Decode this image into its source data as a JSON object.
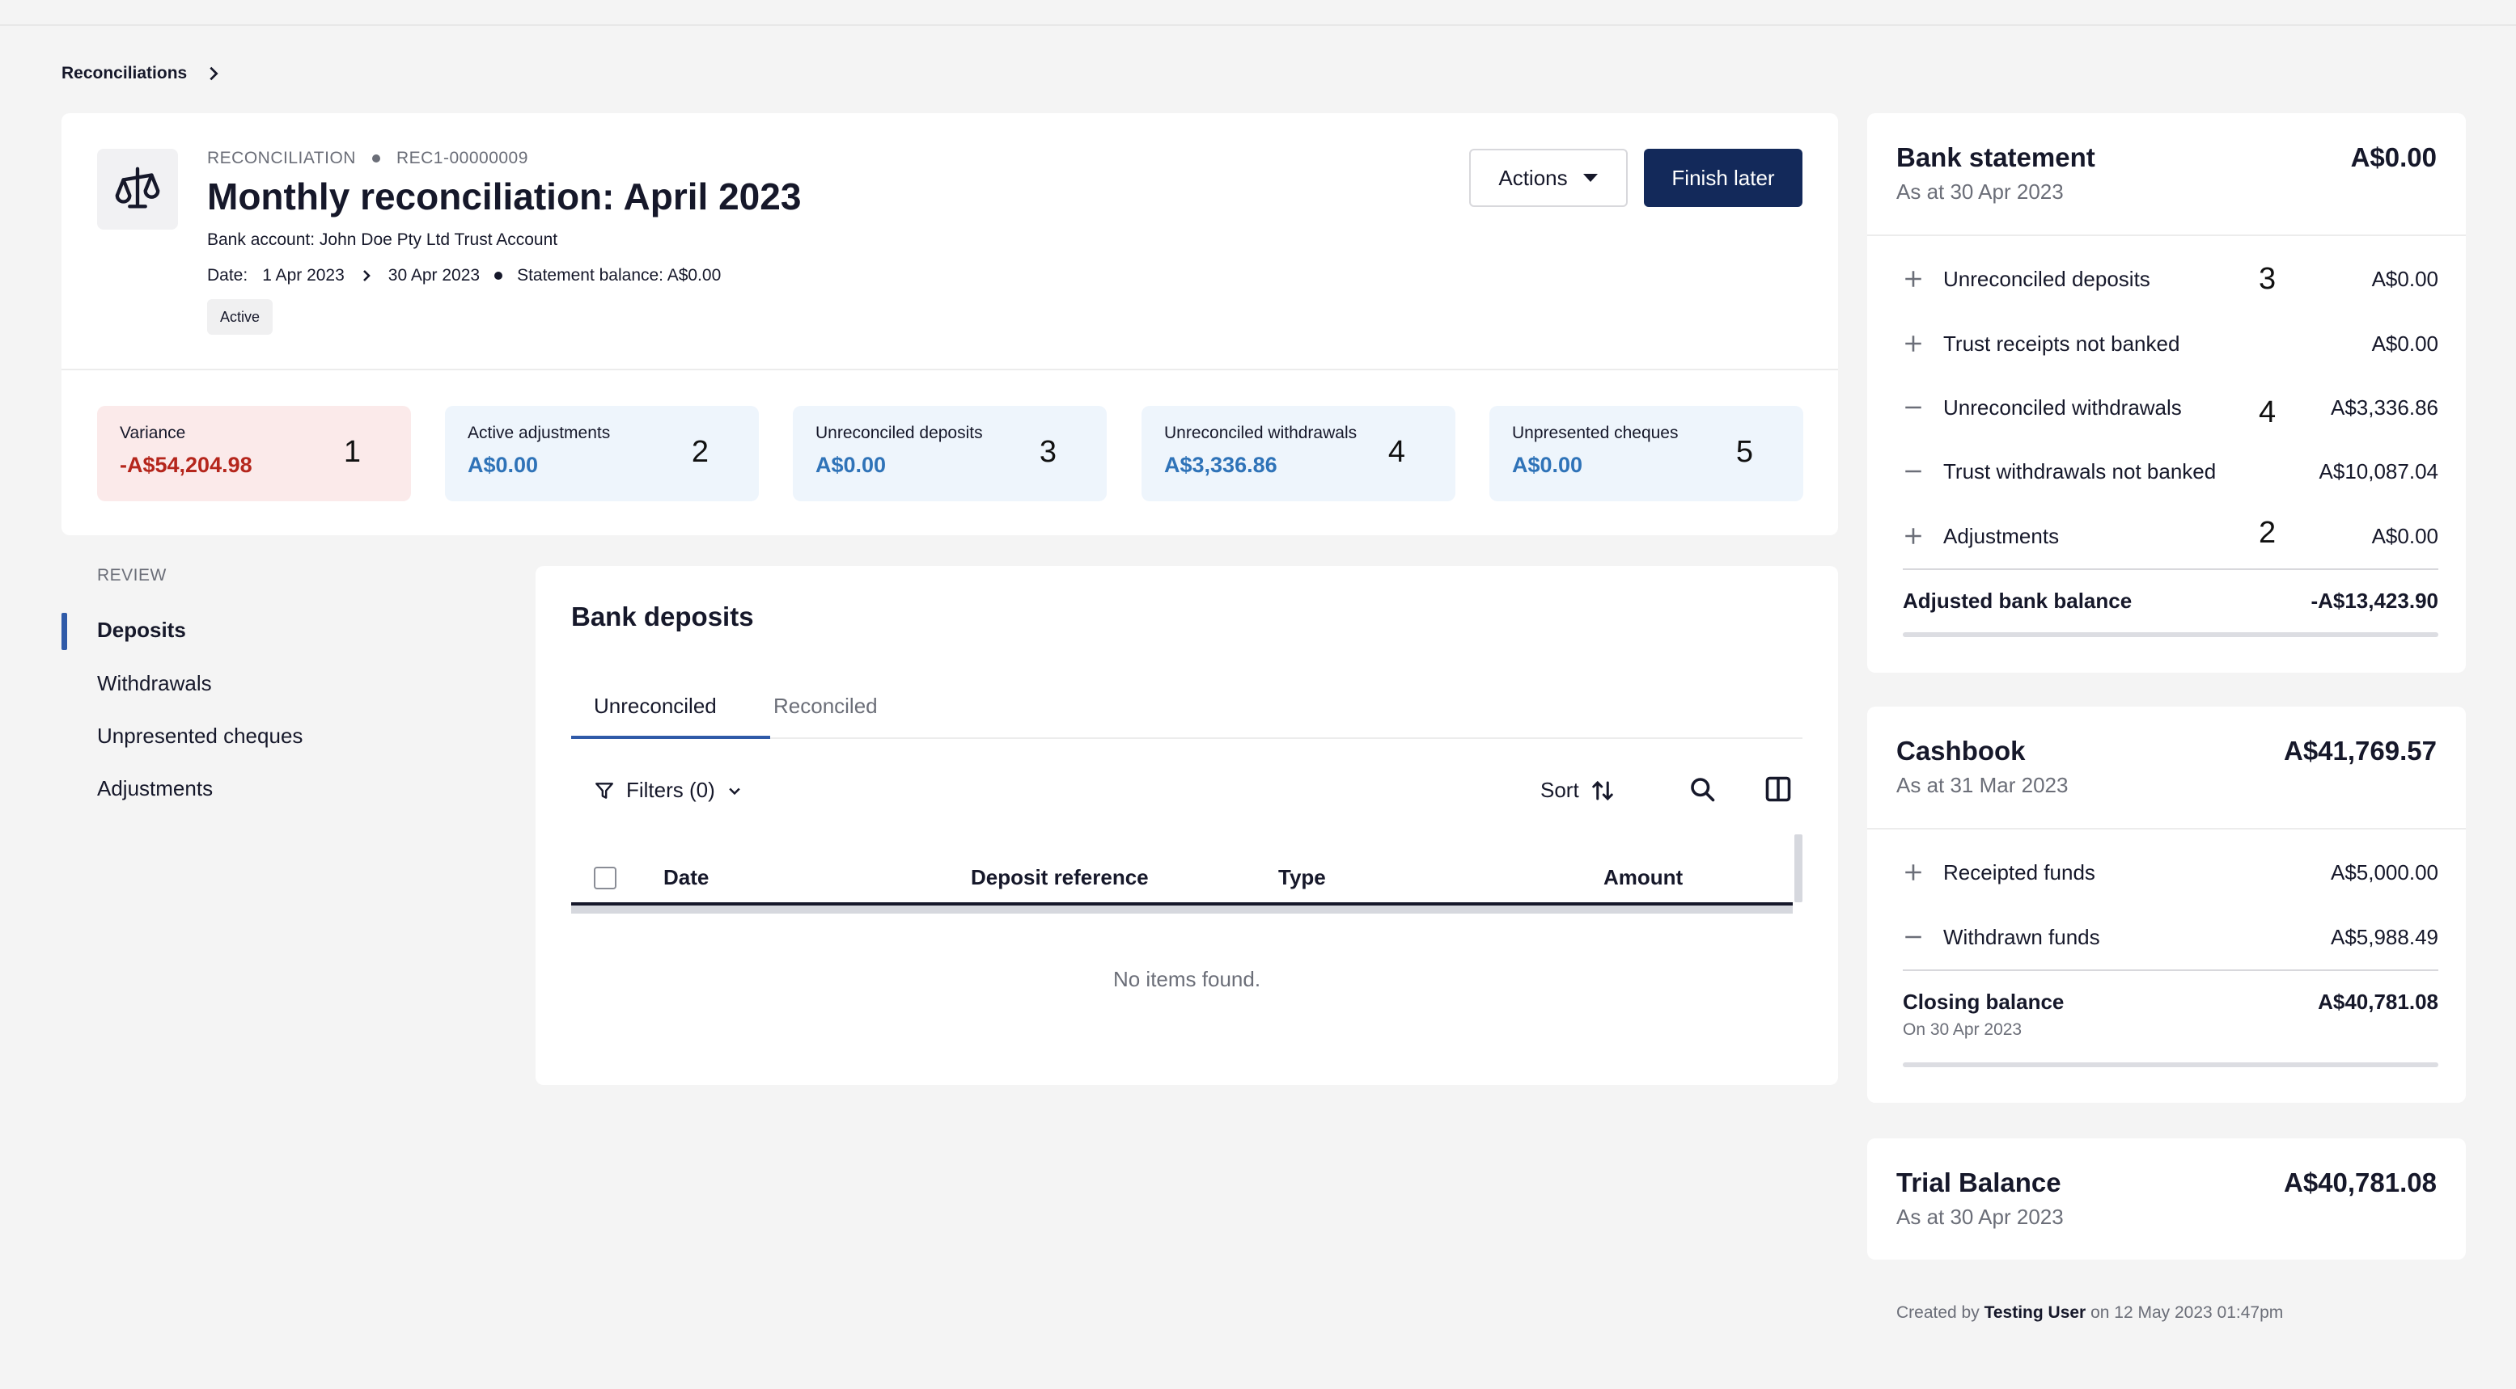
{
  "breadcrumb": {
    "root": "Reconciliations"
  },
  "header": {
    "kind_label": "RECONCILIATION",
    "reference": "REC1-00000009",
    "title": "Monthly reconciliation: April 2023",
    "bank_account": "Bank account: John Doe Pty Ltd Trust Account",
    "date_label": "Date:",
    "date_from": "1 Apr 2023",
    "date_to": "30 Apr 2023",
    "statement_balance": "Statement balance: A$0.00",
    "status": "Active",
    "actions_label": "Actions",
    "finish_label": "Finish later",
    "icon": "scales-icon"
  },
  "stats": [
    {
      "label": "Variance",
      "value": "-A$54,204.98",
      "num": "1"
    },
    {
      "label": "Active adjustments",
      "value": "A$0.00",
      "num": "2"
    },
    {
      "label": "Unreconciled deposits",
      "value": "A$0.00",
      "num": "3"
    },
    {
      "label": "Unreconciled withdrawals",
      "value": "A$3,336.86",
      "num": "4"
    },
    {
      "label": "Unpresented cheques",
      "value": "A$0.00",
      "num": "5"
    }
  ],
  "review": {
    "title": "REVIEW",
    "items": [
      "Deposits",
      "Withdrawals",
      "Unpresented cheques",
      "Adjustments"
    ],
    "active": "Deposits"
  },
  "deposits": {
    "title": "Bank deposits",
    "tabs": [
      "Unreconciled",
      "Reconciled"
    ],
    "filters_label": "Filters (0)",
    "sort_label": "Sort",
    "columns": [
      "Date",
      "Deposit reference",
      "Type",
      "Amount"
    ],
    "empty_message": "No items found."
  },
  "bank_statement": {
    "title": "Bank statement",
    "subtitle": "As at 30 Apr 2023",
    "total": "A$0.00",
    "rows": [
      {
        "sign": "plus",
        "label": "Unreconciled deposits",
        "num": "3",
        "amount": "A$0.00"
      },
      {
        "sign": "plus",
        "label": "Trust receipts not banked",
        "num": "",
        "amount": "A$0.00"
      },
      {
        "sign": "minus",
        "label": "Unreconciled withdrawals",
        "num": "4",
        "amount": "A$3,336.86"
      },
      {
        "sign": "minus",
        "label": "Trust withdrawals not banked",
        "num": "",
        "amount": "A$10,087.04"
      },
      {
        "sign": "plus",
        "label": "Adjustments",
        "num": "2",
        "amount": "A$0.00"
      }
    ],
    "adjusted_label": "Adjusted bank balance",
    "adjusted_amount": "-A$13,423.90"
  },
  "cashbook": {
    "title": "Cashbook",
    "subtitle": "As at 31 Mar 2023",
    "total": "A$41,769.57",
    "rows": [
      {
        "sign": "plus",
        "label": "Receipted funds",
        "amount": "A$5,000.00"
      },
      {
        "sign": "minus",
        "label": "Withdrawn funds",
        "amount": "A$5,988.49"
      }
    ],
    "closing_label": "Closing balance",
    "closing_sub": "On 30 Apr 2023",
    "closing_amount": "A$40,781.08"
  },
  "trial_balance": {
    "title": "Trial Balance",
    "subtitle": "As at 30 Apr 2023",
    "total": "A$40,781.08"
  },
  "footer": {
    "created_prefix": "Created by",
    "created_user": "Testing User",
    "created_suffix": "on 12 May 2023 01:47pm"
  }
}
